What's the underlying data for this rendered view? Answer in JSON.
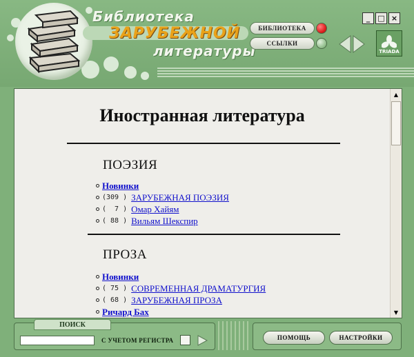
{
  "header": {
    "title_line1": "Библиотека",
    "title_line2": "ЗАРУБЕЖНОЙ",
    "title_line3": "литературы",
    "nav_library": "БИБЛИОТЕКА",
    "nav_links": "ССЫЛКИ",
    "minimize": "_",
    "maximize": "□",
    "close": "×",
    "brand": "TRIADA"
  },
  "content": {
    "page_title": "Иностранная литература",
    "poetry": {
      "title": "ПОЭЗИЯ",
      "items": [
        {
          "count": "",
          "label": "Новинки",
          "bold": true
        },
        {
          "count": "(309 )",
          "label": "ЗАРУБЕЖНАЯ ПОЭЗИЯ",
          "bold": false
        },
        {
          "count": "(  7 )",
          "label": "Омар Хайям",
          "bold": false
        },
        {
          "count": "( 88 )",
          "label": "Вильям Шекспир",
          "bold": false
        }
      ]
    },
    "prose": {
      "title": "ПРОЗА",
      "items": [
        {
          "count": "",
          "label": "Новинки",
          "bold": true
        },
        {
          "count": "( 75 )",
          "label": "СОВРЕМЕННАЯ ДРАМАТУРГИЯ",
          "bold": false
        },
        {
          "count": "( 68 )",
          "label": "ЗАРУБЕЖНАЯ ПРОЗА",
          "bold": false
        },
        {
          "count": "",
          "label": "Ричард Бах",
          "bold": true
        }
      ]
    }
  },
  "footer": {
    "search_tab": "ПОИСК",
    "search_value": "",
    "case_label": "С УЧЕТОМ РЕГИСТРА",
    "help_button": "ПОМОЩЬ",
    "settings_button": "НАСТРОЙКИ"
  },
  "colors": {
    "frame_green": "#7fb07a",
    "content_bg": "#efeeea",
    "link_blue": "#1010cc",
    "title_orange": "#e9a21a",
    "led_red": "#e02020"
  },
  "icons": [
    "books-logo",
    "led-red",
    "led-off",
    "nav-left-arrow",
    "nav-right-arrow",
    "triada-logo",
    "scroll-up-arrow",
    "scroll-down-arrow",
    "search-go-arrow"
  ]
}
